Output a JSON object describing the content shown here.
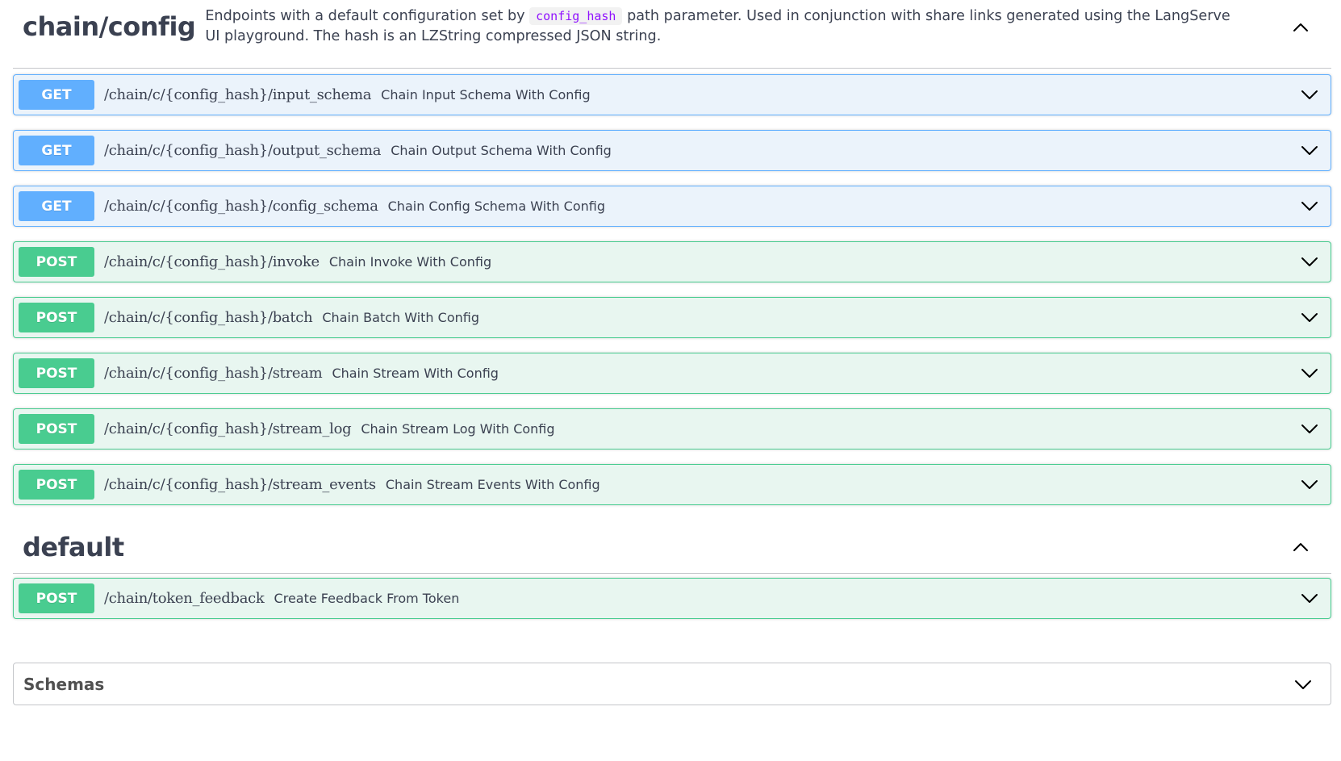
{
  "sections": [
    {
      "title": "chain/config",
      "description": {
        "before": "Endpoints with a default configuration set by",
        "code": "config_hash",
        "after": "path parameter. Used in conjunction with share links generated using the LangServe UI playground. The hash is an LZString compressed JSON string."
      },
      "operations": [
        {
          "method": "GET",
          "path": "/chain/c/{config_hash}/input_schema",
          "summary": "Chain Input Schema With Config"
        },
        {
          "method": "GET",
          "path": "/chain/c/{config_hash}/output_schema",
          "summary": "Chain Output Schema With Config"
        },
        {
          "method": "GET",
          "path": "/chain/c/{config_hash}/config_schema",
          "summary": "Chain Config Schema With Config"
        },
        {
          "method": "POST",
          "path": "/chain/c/{config_hash}/invoke",
          "summary": "Chain Invoke With Config"
        },
        {
          "method": "POST",
          "path": "/chain/c/{config_hash}/batch",
          "summary": "Chain Batch With Config"
        },
        {
          "method": "POST",
          "path": "/chain/c/{config_hash}/stream",
          "summary": "Chain Stream With Config"
        },
        {
          "method": "POST",
          "path": "/chain/c/{config_hash}/stream_log",
          "summary": "Chain Stream Log With Config"
        },
        {
          "method": "POST",
          "path": "/chain/c/{config_hash}/stream_events",
          "summary": "Chain Stream Events With Config"
        }
      ]
    },
    {
      "title": "default",
      "operations": [
        {
          "method": "POST",
          "path": "/chain/token_feedback",
          "summary": "Create Feedback From Token"
        }
      ]
    }
  ],
  "schemas": {
    "title": "Schemas"
  },
  "icons": {
    "collapse": "chevron-up-icon",
    "expand": "chevron-down-icon"
  },
  "colors": {
    "get_accent": "#61affe",
    "get_bg": "#ebf3fb",
    "post_accent": "#49cc90",
    "post_bg": "#e8f6f0",
    "code_text": "#9012fe",
    "text": "#3b4151"
  }
}
